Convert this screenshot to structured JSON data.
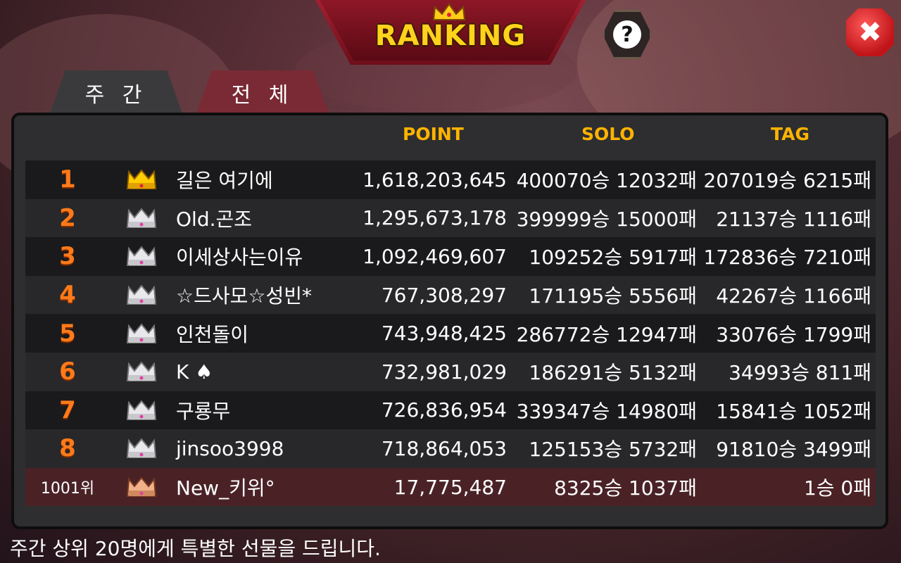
{
  "title": "RANKING",
  "tabs": {
    "weekly": "주 간",
    "all": "전 체"
  },
  "columns": {
    "point": "POINT",
    "solo": "SOLO",
    "tag": "TAG"
  },
  "rows": [
    {
      "rank": "1",
      "name": "길은 여기에",
      "point": "1,618,203,645",
      "solo": "400070승 12032패",
      "tag": "207019승 6215패",
      "crown": "gold"
    },
    {
      "rank": "2",
      "name": "Old.곤조",
      "point": "1,295,673,178",
      "solo": "399999승 15000패",
      "tag": "21137승 1116패",
      "crown": "silver"
    },
    {
      "rank": "3",
      "name": "이세상사는이유",
      "point": "1,092,469,607",
      "solo": "109252승 5917패",
      "tag": "172836승 7210패",
      "crown": "silver"
    },
    {
      "rank": "4",
      "name": "☆드사모☆성빈*",
      "point": "767,308,297",
      "solo": "171195승 5556패",
      "tag": "42267승 1166패",
      "crown": "silver"
    },
    {
      "rank": "5",
      "name": "인천돌이",
      "point": "743,948,425",
      "solo": "286772승 12947패",
      "tag": "33076승 1799패",
      "crown": "silver"
    },
    {
      "rank": "6",
      "name": "K ♠",
      "point": "732,981,029",
      "solo": "186291승 5132패",
      "tag": "34993승 811패",
      "crown": "silver"
    },
    {
      "rank": "7",
      "name": "구룡무",
      "point": "726,836,954",
      "solo": "339347승 14980패",
      "tag": "15841승 1052패",
      "crown": "silver"
    },
    {
      "rank": "8",
      "name": "jinsoo3998",
      "point": "718,864,053",
      "solo": "125153승 5732패",
      "tag": "91810승 3499패",
      "crown": "silver"
    },
    {
      "rank": "1001위",
      "name": "New_키위°",
      "point": "17,775,487",
      "solo": "8325승 1037패",
      "tag": "1승 0패",
      "crown": "bronze"
    }
  ],
  "footer": "주간 상위 20명에게 특별한 선물을 드립니다.",
  "icons": {
    "help": "?",
    "close": "✖"
  },
  "colors": {
    "accent": "#ffb400",
    "rank": "#ff7a1a",
    "banner": "#8e1726"
  }
}
